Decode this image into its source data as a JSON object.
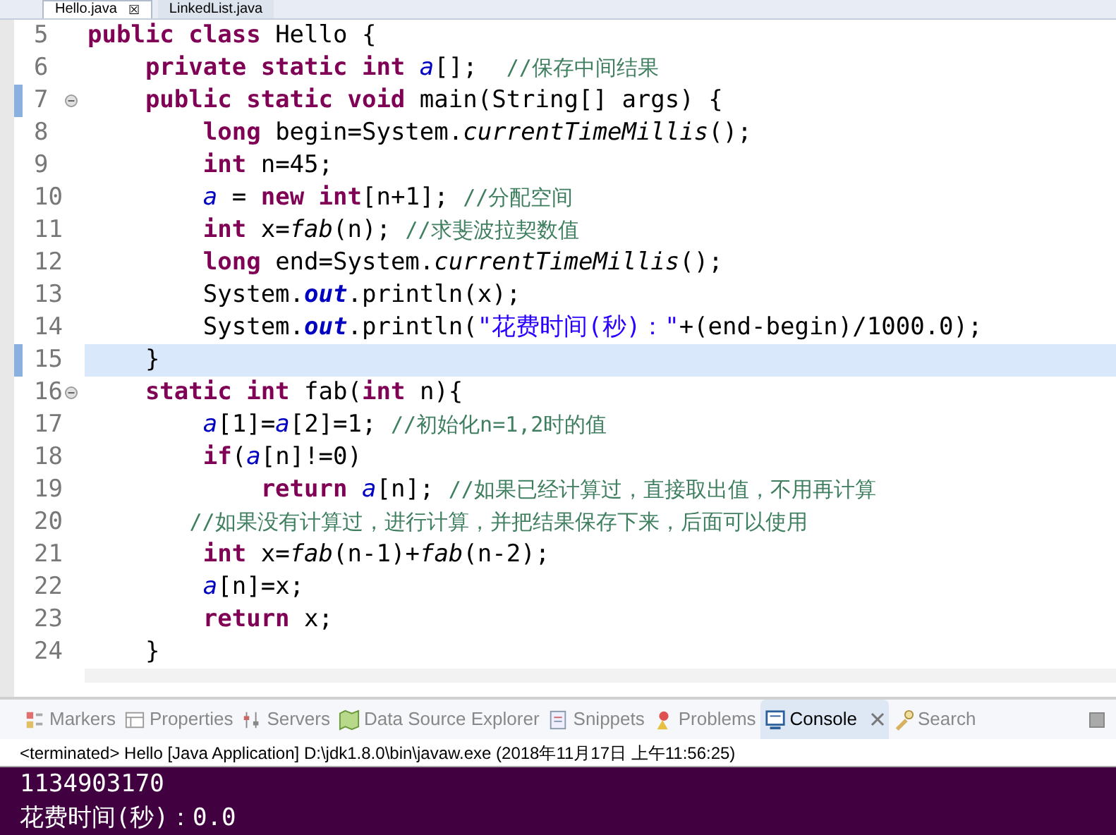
{
  "editor_tabs": [
    {
      "label": "Hello.java",
      "selected": true,
      "close": "☒"
    },
    {
      "label": "LinkedList.java",
      "selected": false
    }
  ],
  "code_lines": [
    {
      "number": "5",
      "fold": false,
      "current": false,
      "marker": false,
      "tokens": [
        {
          "kind": "keyword",
          "text": "public class"
        },
        {
          "kind": "plain",
          "text": " Hello {"
        }
      ]
    },
    {
      "number": "6",
      "fold": false,
      "current": false,
      "marker": false,
      "tokens": [
        {
          "kind": "keyword",
          "text": "    private static int"
        },
        {
          "kind": "field",
          "text": " a"
        },
        {
          "kind": "plain",
          "text": "[];  "
        },
        {
          "kind": "comment",
          "text": "//保存中间结果"
        }
      ]
    },
    {
      "number": "7",
      "fold": true,
      "current": false,
      "marker": true,
      "tokens": [
        {
          "kind": "keyword",
          "text": "    public static void"
        },
        {
          "kind": "plain",
          "text": " main(String[] args) {"
        }
      ]
    },
    {
      "number": "8",
      "fold": false,
      "current": false,
      "marker": false,
      "tokens": [
        {
          "kind": "keyword",
          "text": "        long"
        },
        {
          "kind": "plain",
          "text": " begin=System."
        },
        {
          "kind": "static_method",
          "text": "currentTimeMillis"
        },
        {
          "kind": "plain",
          "text": "();"
        }
      ]
    },
    {
      "number": "9",
      "fold": false,
      "current": false,
      "marker": false,
      "tokens": [
        {
          "kind": "keyword",
          "text": "        int"
        },
        {
          "kind": "plain",
          "text": " n=45;"
        }
      ]
    },
    {
      "number": "10",
      "fold": false,
      "current": false,
      "marker": false,
      "tokens": [
        {
          "kind": "field",
          "text": "        a"
        },
        {
          "kind": "plain",
          "text": " = "
        },
        {
          "kind": "keyword",
          "text": "new int"
        },
        {
          "kind": "plain",
          "text": "[n+1]; "
        },
        {
          "kind": "comment",
          "text": "//分配空间"
        }
      ]
    },
    {
      "number": "11",
      "fold": false,
      "current": false,
      "marker": false,
      "tokens": [
        {
          "kind": "keyword",
          "text": "        int"
        },
        {
          "kind": "plain",
          "text": " x="
        },
        {
          "kind": "static_method",
          "text": "fab"
        },
        {
          "kind": "plain",
          "text": "(n); "
        },
        {
          "kind": "comment",
          "text": "//求斐波拉契数值"
        }
      ]
    },
    {
      "number": "12",
      "fold": false,
      "current": false,
      "marker": false,
      "tokens": [
        {
          "kind": "keyword",
          "text": "        long"
        },
        {
          "kind": "plain",
          "text": " end=System."
        },
        {
          "kind": "static_method",
          "text": "currentTimeMillis"
        },
        {
          "kind": "plain",
          "text": "();"
        }
      ]
    },
    {
      "number": "13",
      "fold": false,
      "current": false,
      "marker": false,
      "tokens": [
        {
          "kind": "plain",
          "text": "        System."
        },
        {
          "kind": "static_field",
          "text": "out"
        },
        {
          "kind": "plain",
          "text": ".println(x);"
        }
      ]
    },
    {
      "number": "14",
      "fold": false,
      "current": false,
      "marker": false,
      "tokens": [
        {
          "kind": "plain",
          "text": "        System."
        },
        {
          "kind": "static_field",
          "text": "out"
        },
        {
          "kind": "plain",
          "text": ".println("
        },
        {
          "kind": "string",
          "text": "\"花费时间(秒)：\""
        },
        {
          "kind": "plain",
          "text": "+(end-begin)/1000.0);"
        }
      ]
    },
    {
      "number": "15",
      "fold": false,
      "current": true,
      "marker": true,
      "tokens": [
        {
          "kind": "plain",
          "text": "    }"
        }
      ]
    },
    {
      "number": "16",
      "fold": true,
      "current": false,
      "marker": false,
      "tokens": [
        {
          "kind": "keyword",
          "text": "    static int"
        },
        {
          "kind": "plain",
          "text": " fab("
        },
        {
          "kind": "keyword",
          "text": "int"
        },
        {
          "kind": "plain",
          "text": " n){"
        }
      ]
    },
    {
      "number": "17",
      "fold": false,
      "current": false,
      "marker": false,
      "tokens": [
        {
          "kind": "field",
          "text": "        a"
        },
        {
          "kind": "plain",
          "text": "[1]="
        },
        {
          "kind": "field",
          "text": "a"
        },
        {
          "kind": "plain",
          "text": "[2]=1; "
        },
        {
          "kind": "comment",
          "text": "//初始化n=1,2时的值"
        }
      ]
    },
    {
      "number": "18",
      "fold": false,
      "current": false,
      "marker": false,
      "tokens": [
        {
          "kind": "keyword",
          "text": "        if"
        },
        {
          "kind": "plain",
          "text": "("
        },
        {
          "kind": "field",
          "text": "a"
        },
        {
          "kind": "plain",
          "text": "[n]!=0)"
        }
      ]
    },
    {
      "number": "19",
      "fold": false,
      "current": false,
      "marker": false,
      "tokens": [
        {
          "kind": "keyword",
          "text": "            return"
        },
        {
          "kind": "field",
          "text": " a"
        },
        {
          "kind": "plain",
          "text": "[n]; "
        },
        {
          "kind": "comment",
          "text": "//如果已经计算过，直接取出值，不用再计算"
        }
      ]
    },
    {
      "number": "20",
      "fold": false,
      "current": false,
      "marker": false,
      "tokens": [
        {
          "kind": "comment",
          "text": "        //如果没有计算过，进行计算，并把结果保存下来，后面可以使用"
        }
      ]
    },
    {
      "number": "21",
      "fold": false,
      "current": false,
      "marker": false,
      "tokens": [
        {
          "kind": "keyword",
          "text": "        int"
        },
        {
          "kind": "plain",
          "text": " x="
        },
        {
          "kind": "static_method",
          "text": "fab"
        },
        {
          "kind": "plain",
          "text": "(n-1)+"
        },
        {
          "kind": "static_method",
          "text": "fab"
        },
        {
          "kind": "plain",
          "text": "(n-2);"
        }
      ]
    },
    {
      "number": "22",
      "fold": false,
      "current": false,
      "marker": false,
      "tokens": [
        {
          "kind": "field",
          "text": "        a"
        },
        {
          "kind": "plain",
          "text": "[n]=x;"
        }
      ]
    },
    {
      "number": "23",
      "fold": false,
      "current": false,
      "marker": false,
      "tokens": [
        {
          "kind": "keyword",
          "text": "        return"
        },
        {
          "kind": "plain",
          "text": " x;"
        }
      ]
    },
    {
      "number": "24",
      "fold": false,
      "current": false,
      "marker": false,
      "tokens": [
        {
          "kind": "plain",
          "text": "    }"
        }
      ]
    }
  ],
  "panel_tabs": [
    {
      "label": "Markers",
      "selected": false
    },
    {
      "label": "Properties",
      "selected": false
    },
    {
      "label": "Servers",
      "selected": false
    },
    {
      "label": "Data Source Explorer",
      "selected": false
    },
    {
      "label": "Snippets",
      "selected": false
    },
    {
      "label": "Problems",
      "selected": false
    },
    {
      "label": "Console",
      "selected": true
    },
    {
      "label": "Search",
      "selected": false
    }
  ],
  "console": {
    "header": "<terminated> Hello [Java Application] D:\\jdk1.8.0\\bin\\javaw.exe (2018年11月17日 上午11:56:25)",
    "output": [
      "1134903170",
      "花费时间(秒)：0.0"
    ]
  }
}
